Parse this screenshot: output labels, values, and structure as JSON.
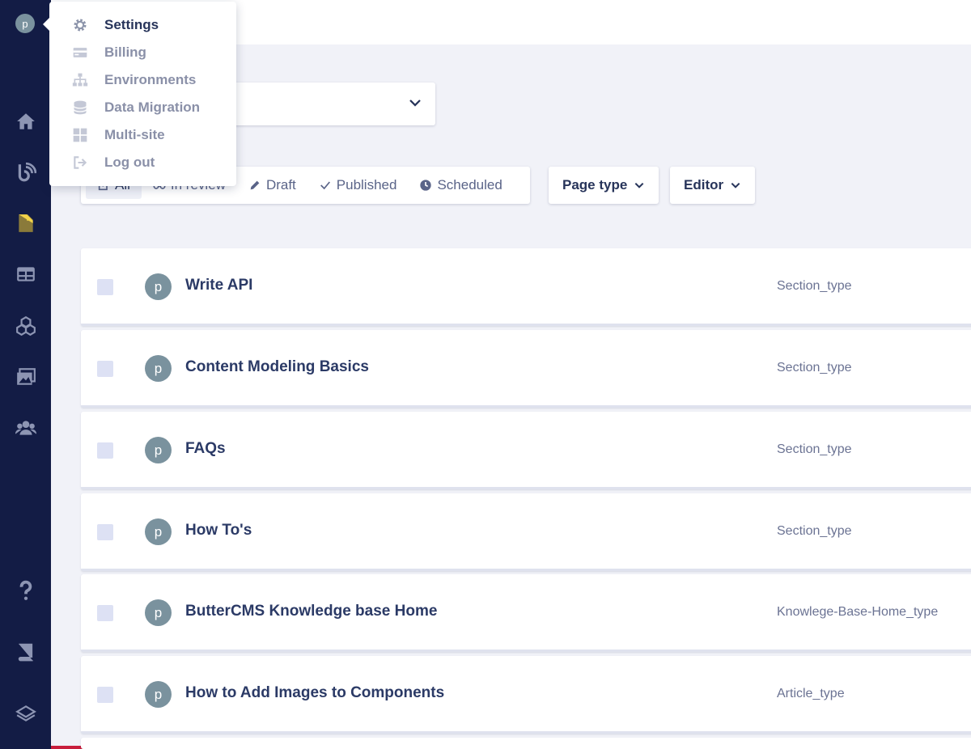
{
  "user": {
    "initial": "p"
  },
  "menu": {
    "items": [
      {
        "label": "Settings",
        "icon": "gear-icon"
      },
      {
        "label": "Billing",
        "icon": "credit-card-icon"
      },
      {
        "label": "Environments",
        "icon": "sitemap-icon"
      },
      {
        "label": "Data Migration",
        "icon": "database-icon"
      },
      {
        "label": "Multi-site",
        "icon": "grid-icon"
      },
      {
        "label": "Log out",
        "icon": "logout-icon"
      }
    ]
  },
  "filters": {
    "all": "All",
    "in_review": "In review",
    "draft": "Draft",
    "published": "Published",
    "scheduled": "Scheduled"
  },
  "dropdowns": {
    "page_type": "Page type",
    "editor": "Editor"
  },
  "pages": [
    {
      "initial": "p",
      "title": "Write API",
      "type": "Section_type"
    },
    {
      "initial": "p",
      "title": "Content Modeling Basics",
      "type": "Section_type"
    },
    {
      "initial": "p",
      "title": "FAQs",
      "type": "Section_type"
    },
    {
      "initial": "p",
      "title": "How To's",
      "type": "Section_type"
    },
    {
      "initial": "p",
      "title": "ButterCMS Knowledge base Home",
      "type": "Knowlege-Base-Home_type"
    },
    {
      "initial": "p",
      "title": "How to Add Images to Components",
      "type": "Article_type"
    }
  ],
  "colors": {
    "sidebar": "#131c45",
    "accent": "#f3d34a",
    "avatar": "#7a929e",
    "checkbox": "#dde1f4"
  }
}
